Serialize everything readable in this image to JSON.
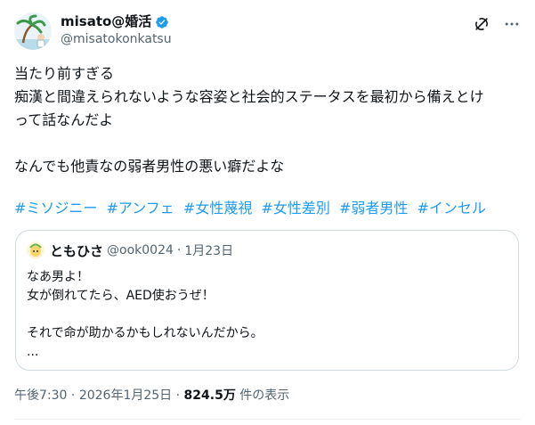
{
  "author": {
    "display_name": "misato@婚活",
    "handle": "@misatokonkatsu"
  },
  "tweet": {
    "lines": [
      "当たり前すぎる",
      "痴漢と間違えられないような容姿と社会的ステータスを最初から備えとけ",
      "って話なんだよ",
      "",
      "なんでも他責なの弱者男性の悪い癖だよな"
    ],
    "hashtags": [
      "#ミソジニー",
      "#アンフェ",
      "#女性蔑視",
      "#女性差別",
      "#弱者男性",
      "#インセル"
    ]
  },
  "quote": {
    "display_name": "ともひさ",
    "handle": "@ook0024",
    "date": "1月23日",
    "separator": "·",
    "lines": [
      "なあ男よ！",
      "女が倒れてたら、AED使おうぜ！",
      "",
      "それで命が助かるかもしれないんだから。",
      "..."
    ]
  },
  "meta": {
    "time": "午後7:30",
    "date": "2026年1月25日",
    "separator": "·",
    "views": "824.5万",
    "views_label": "件の表示"
  },
  "colors": {
    "accent": "#1d9bf0",
    "text": "#0f1419",
    "muted": "#536471",
    "border": "#cfd9de"
  },
  "icons": [
    "verified-badge-icon",
    "grok-icon",
    "more-options-icon"
  ]
}
